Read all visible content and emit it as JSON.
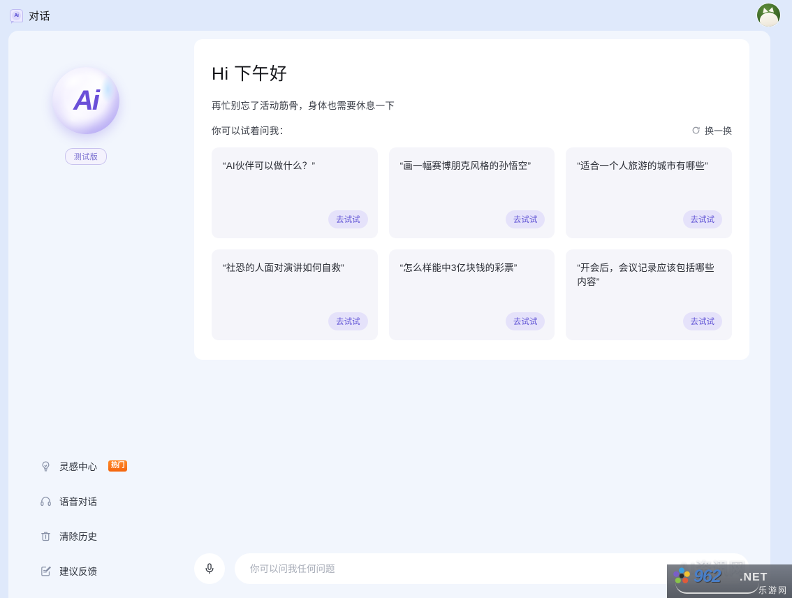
{
  "topbar": {
    "logo_icon": "ai-chat-bubble-icon",
    "logo_text": "Ai",
    "title": "对话",
    "avatar_icon": "user-avatar"
  },
  "sidebar": {
    "orb_text": "Ai",
    "beta_badge": "测试版",
    "menu": [
      {
        "icon": "lightbulb-icon",
        "label": "灵感中心",
        "badge": "热门"
      },
      {
        "icon": "headphones-icon",
        "label": "语音对话",
        "badge": ""
      },
      {
        "icon": "trash-icon",
        "label": "清除历史",
        "badge": ""
      },
      {
        "icon": "feedback-edit-icon",
        "label": "建议反馈",
        "badge": ""
      }
    ]
  },
  "main": {
    "greeting": "Hi 下午好",
    "subtitle": "再忙别忘了活动筋骨，身体也需要休息一下",
    "ask_label": "你可以试着问我：",
    "refresh": {
      "icon": "refresh-circle-icon",
      "label": "换一换"
    },
    "try_label": "去试试",
    "suggestions": [
      {
        "text": "“AI伙伴可以做什么？”"
      },
      {
        "text": "“画一幅赛博朋克风格的孙悟空”"
      },
      {
        "text": "“适合一个人旅游的城市有哪些”"
      },
      {
        "text": "“社恐的人面对演讲如何自救”"
      },
      {
        "text": "“怎么样能中3亿块钱的彩票”"
      },
      {
        "text": "“开会后，会议记录应该包括哪些内容”"
      }
    ]
  },
  "composer": {
    "mic_icon": "microphone-icon",
    "placeholder": "你可以问我任何问题",
    "value": ""
  },
  "watermark": {
    "overlay_text": "AI资讯网",
    "brand": "962",
    "tld": ".NET",
    "site_cn": "乐游网"
  },
  "colors": {
    "page_bg": "#dfe9fb",
    "panel_bg": "#f2f6fd",
    "card_bg": "#ffffff",
    "suggestion_bg": "#f5f5fa",
    "accent_purple": "#6255d6",
    "try_btn_bg": "#e5e2fa",
    "hot_badge": "#f4650d"
  }
}
